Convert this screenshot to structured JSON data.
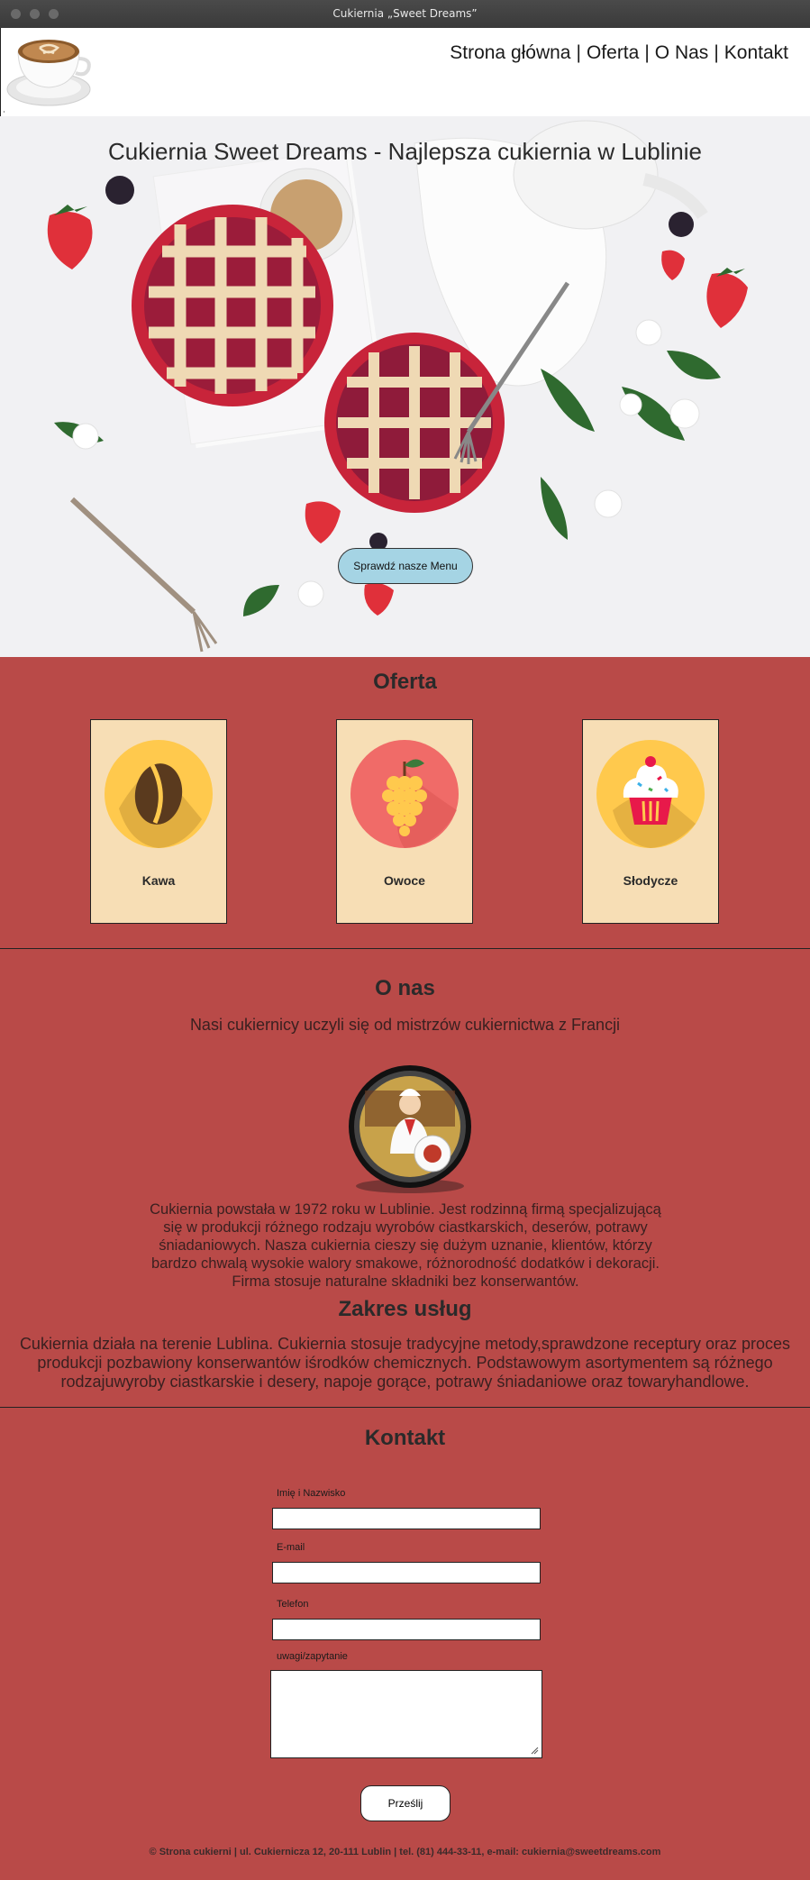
{
  "window": {
    "title": "Cukiernia „Sweet Dreams”"
  },
  "nav": {
    "items": [
      "Strona główna",
      "Oferta",
      "O Nas",
      "Kontakt"
    ],
    "separator": "|"
  },
  "hero": {
    "title": "Cukiernia Sweet Dreams - Najlepsza cukiernia w Lublinie",
    "button_label": "Sprawdź nasze Menu"
  },
  "offer": {
    "heading": "Oferta",
    "cards": [
      {
        "label": "Kawa",
        "icon": "coffee-bean-icon",
        "color": "#ffc94d"
      },
      {
        "label": "Owoce",
        "icon": "grapes-icon",
        "color": "#f06b68"
      },
      {
        "label": "Słodycze",
        "icon": "cupcake-icon",
        "color": "#ffc94d"
      }
    ]
  },
  "about": {
    "heading": "O nas",
    "subtitle": "Nasi cukiernicy uczyli się od mistrzów cukiernictwa z Francji",
    "text": "Cukiernia powstała w 1972 roku w Lublinie. Jest rodzinną firmą specjalizującą się w produkcji różnego rodzaju wyrobów ciastkarskich, deserów, potrawy śniadaniowych. Nasza cukiernia cieszy się dużym uznanie, klientów, którzy bardzo chwalą wysokie walory smakowe, różnorodność dodatków i dekoracji. Firma stosuje naturalne składniki bez konserwantów.",
    "services_heading": "Zakres usług",
    "services_text": "Cukiernia działa na terenie Lublina. Cukiernia stosuje tradycyjne metody,sprawdzone receptury oraz proces produkcji pozbawiony konserwantów iśrodków chemicznych. Podstawowym asortymentem są różnego rodzajuwyroby ciastkarskie i desery, napoje gorące, potrawy śniadaniowe oraz towaryhandlowe."
  },
  "contact": {
    "heading": "Kontakt",
    "fields": {
      "name_label": "Imię i Nazwisko",
      "email_label": "E-mail",
      "phone_label": "Telefon",
      "message_label": "uwagi/zapytanie"
    },
    "submit_label": "Prześlij"
  },
  "footer": {
    "text": "© Strona cukierni | ul. Cukiernicza 12, 20-111 Lublin | tel. (81) 444-33-11, e-mail: cukiernia@sweetdreams.com"
  },
  "colors": {
    "accent": "#b94a48",
    "card": "#f7deb5",
    "button": "#a5d4e4"
  }
}
